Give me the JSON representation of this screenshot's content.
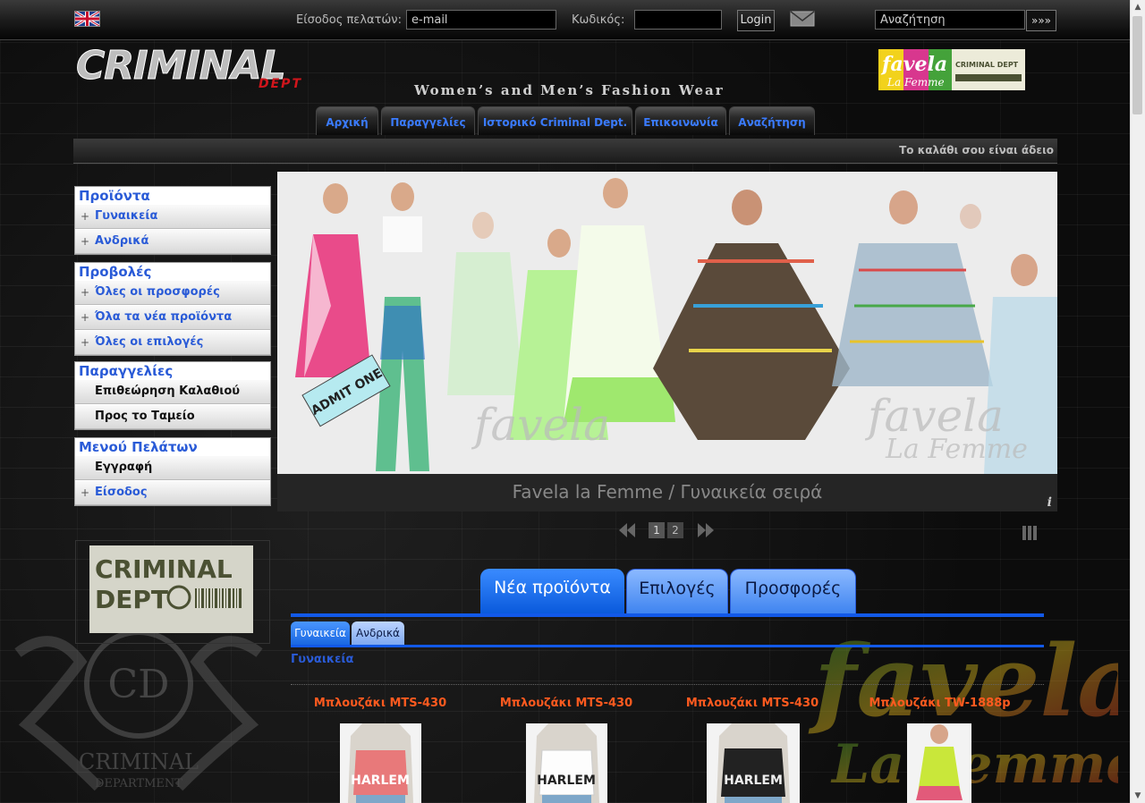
{
  "topbar": {
    "login_label": "Είσοδος πελατών:",
    "email_placeholder": "e-mail",
    "password_label": "Κωδικός:",
    "login_button": "Login",
    "search_placeholder": "Αναζήτηση",
    "search_button": "»»»"
  },
  "header": {
    "logo_text": "CRIMINAL",
    "logo_sub": "DEPT",
    "tagline": "Women’s and Men’s Fashion Wear",
    "banner_text_1": "favela",
    "banner_text_2": "La Femme",
    "banner_text_3": "CRIMINAL DEPT"
  },
  "nav": {
    "tabs": [
      "Αρχική",
      "Παραγγελίες",
      "Ιστορικό Criminal Dept.",
      "Επικοινωνία",
      "Αναζήτηση"
    ]
  },
  "cart": {
    "status": "Το καλάθι σου είναι άδειο"
  },
  "sidebar": {
    "products": {
      "title": "Προϊόντα",
      "items": [
        "Γυναικεία",
        "Ανδρικά"
      ]
    },
    "views": {
      "title": "Προβολές",
      "items": [
        "Όλες οι προσφορές",
        "Όλα τα νέα προϊόντα",
        "Όλες οι επιλογές"
      ]
    },
    "orders": {
      "title": "Παραγγελίες",
      "items": [
        "Επιθεώρηση Καλαθιού",
        "Προς το Ταμείο"
      ]
    },
    "customers": {
      "title": "Μενού Πελάτων",
      "items": [
        "Εγγραφή",
        "Είσοδος"
      ]
    },
    "brand_logo_text": "CRIMINAL",
    "brand_logo_sub": "DEPT",
    "watermark_text": "CRIMINAL",
    "watermark_sub": "DEPARTMENT"
  },
  "slider": {
    "caption": "Favela la Femme / Γυναικεία σειρά",
    "info": "i",
    "pages": [
      "1",
      "2"
    ],
    "current_page": 1,
    "ticket_text": "ADMIT ONE",
    "watermark_1": "favela",
    "watermark_2": "La Femme"
  },
  "products": {
    "tabs": [
      "Νέα προϊόντα",
      "Επιλογές",
      "Προσφορές"
    ],
    "subtabs": [
      "Γυναικεία",
      "Ανδρικά"
    ],
    "section": "Γυναικεία",
    "items": [
      {
        "title": "Μπλουζάκι MTS-430",
        "print": "HARLEM"
      },
      {
        "title": "Μπλουζάκι MTS-430",
        "print": "HARLEM"
      },
      {
        "title": "Μπλουζάκι MTS-430",
        "print": "HARLEM"
      },
      {
        "title": "Μπλουζάκι TW-1888p",
        "print": ""
      }
    ],
    "watermark_1": "favela",
    "watermark_2": "La Femme"
  },
  "colors": {
    "accent_blue": "#2a5bd7",
    "product_title": "#ff5a1f",
    "tab_blue": "#1259e8"
  }
}
